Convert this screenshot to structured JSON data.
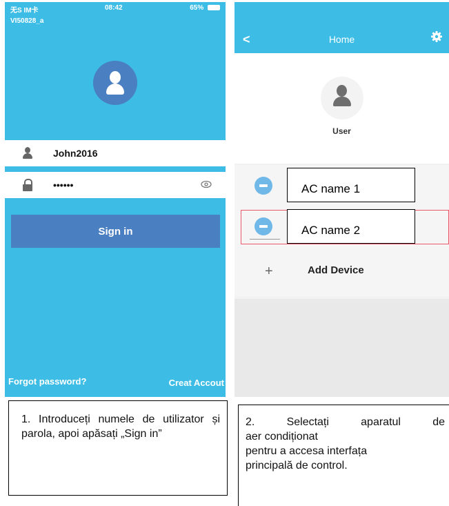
{
  "login": {
    "status": {
      "carrier": "无S IM卡",
      "time": "08:42",
      "battery": "65%"
    },
    "ssid": "VI50828_a",
    "username": "John2016",
    "password_masked": "••••••",
    "sign_in_label": "Sign in",
    "forgot_label": "Forgot password?",
    "create_label": "Creat Accout"
  },
  "home": {
    "nav_title": "Home",
    "back_glyph": "<",
    "user_label": "User",
    "devices": [
      {
        "name": "AC name 1",
        "icon": "ac-unit-icon",
        "selected": false
      },
      {
        "name": "AC name 2",
        "icon": "ac-unit-icon",
        "selected": true
      }
    ],
    "add_glyph": "+",
    "add_device_label": "Add Device"
  },
  "captions": {
    "step1": "1. Introduceți numele de utilizator și parola, apoi apăsați „Sign in”",
    "step2_lines": [
      "2. Selectați aparatul de",
      "aer condiționat",
      "pentru a accesa interfața",
      "principală de control."
    ]
  },
  "colors": {
    "accent": "#3dbde6",
    "button": "#4a7fc2",
    "highlight": "#e8596a"
  }
}
